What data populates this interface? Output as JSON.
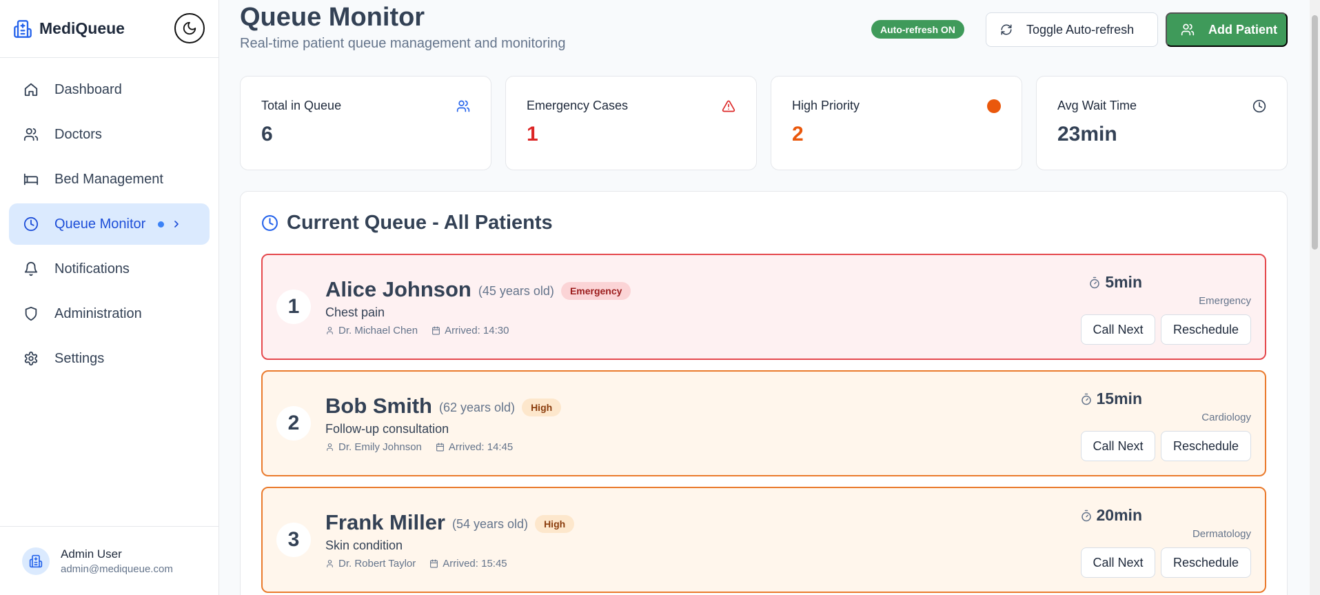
{
  "app": {
    "name": "MediQueue"
  },
  "sidebar": {
    "items": [
      {
        "label": "Dashboard",
        "icon": "home-icon"
      },
      {
        "label": "Doctors",
        "icon": "users-icon"
      },
      {
        "label": "Bed Management",
        "icon": "bed-icon"
      },
      {
        "label": "Queue Monitor",
        "icon": "clock-icon",
        "active": true
      },
      {
        "label": "Notifications",
        "icon": "bell-icon"
      },
      {
        "label": "Administration",
        "icon": "shield-icon"
      },
      {
        "label": "Settings",
        "icon": "gear-icon"
      }
    ],
    "user": {
      "name": "Admin User",
      "email": "admin@mediqueue.com"
    }
  },
  "header": {
    "title": "Queue Monitor",
    "subtitle": "Real-time patient queue management and monitoring",
    "auto_refresh_badge": "Auto-refresh ON",
    "toggle_label": "Toggle Auto-refresh",
    "add_label": "Add Patient"
  },
  "stats": [
    {
      "label": "Total in Queue",
      "value": "6",
      "icon": "users-icon",
      "color": "#334155"
    },
    {
      "label": "Emergency Cases",
      "value": "1",
      "icon": "alert-triangle-icon",
      "color": "#dc2626"
    },
    {
      "label": "High Priority",
      "value": "2",
      "icon": "orange-dot-icon",
      "color": "#ea580c"
    },
    {
      "label": "Avg Wait Time",
      "value": "23min",
      "icon": "clock-icon",
      "color": "#334155"
    }
  ],
  "queue": {
    "title": "Current Queue - All Patients",
    "call_label": "Call Next",
    "reschedule_label": "Reschedule",
    "patients": [
      {
        "position": "1",
        "name": "Alice Johnson",
        "age": "(45 years old)",
        "priority": "Emergency",
        "reason": "Chest pain",
        "doctor": "Dr. Michael Chen",
        "arrived": "Arrived: 14:30",
        "wait": "5min",
        "department": "Emergency"
      },
      {
        "position": "2",
        "name": "Bob Smith",
        "age": "(62 years old)",
        "priority": "High",
        "reason": "Follow-up consultation",
        "doctor": "Dr. Emily Johnson",
        "arrived": "Arrived: 14:45",
        "wait": "15min",
        "department": "Cardiology"
      },
      {
        "position": "3",
        "name": "Frank Miller",
        "age": "(54 years old)",
        "priority": "High",
        "reason": "Skin condition",
        "doctor": "Dr. Robert Taylor",
        "arrived": "Arrived: 15:45",
        "wait": "20min",
        "department": "Dermatology"
      }
    ]
  },
  "colors": {
    "accent": "#2563eb",
    "success": "#3f9a5a",
    "emergency": "#e5484d",
    "high": "#ea7a2c"
  }
}
